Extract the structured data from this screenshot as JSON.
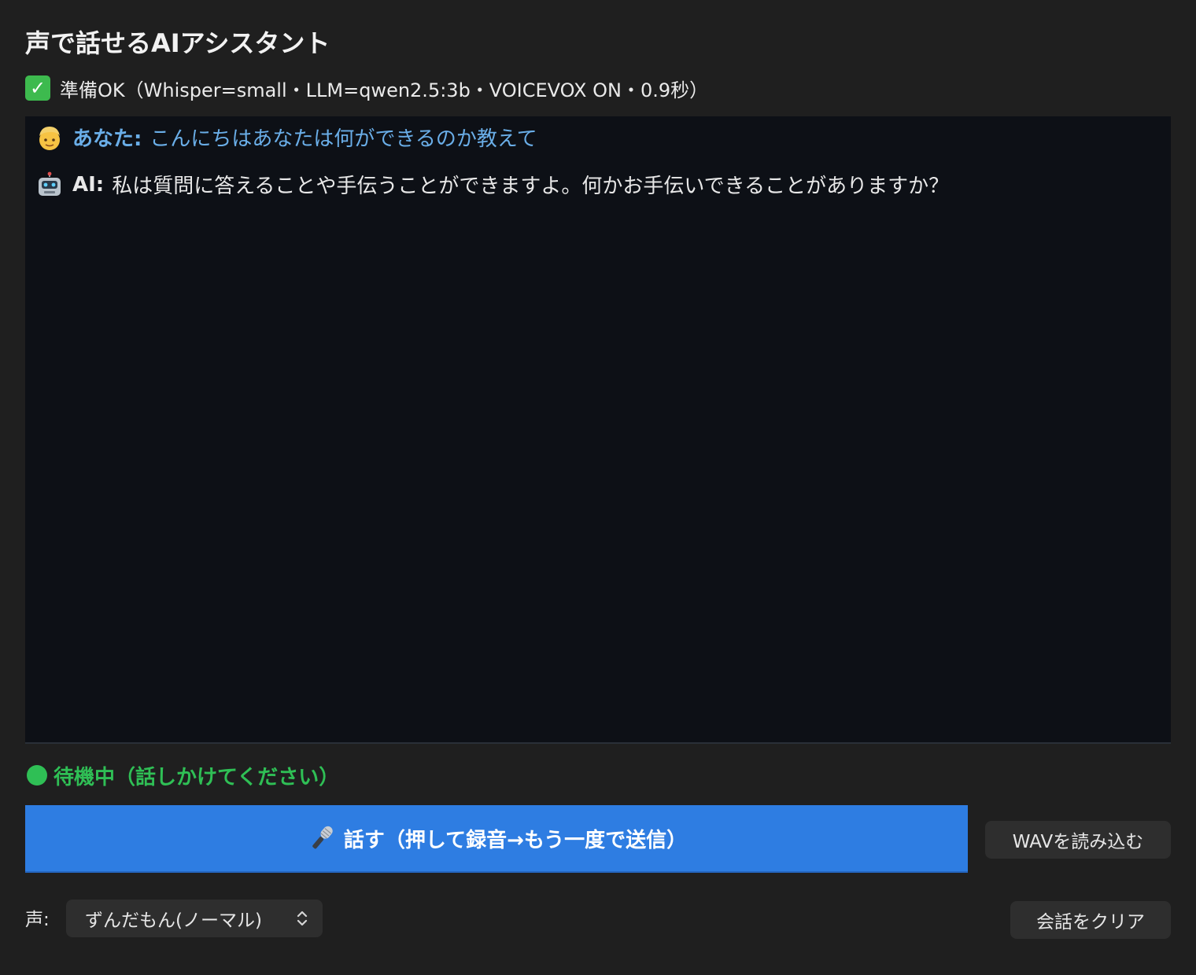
{
  "app": {
    "title": "声で話せるAIアシスタント"
  },
  "status": {
    "icon": "check-icon",
    "text": "準備OK（Whisper=small・LLM=qwen2.5:3b・VOICEVOX ON・0.9秒）"
  },
  "chat": {
    "messages": [
      {
        "avatar_icon": "person-icon",
        "speaker": "あなた:",
        "text": "こんにちはあなたは何ができるのか教えて",
        "color": "#6aaee8"
      },
      {
        "avatar_icon": "robot-icon",
        "speaker": "AI:",
        "text": "私は質問に答えることや手伝うことができますよ。何かお手伝いできることがありますか？",
        "color": "#e8e8e8"
      }
    ]
  },
  "listening": {
    "indicator_icon": "green-dot-icon",
    "text": "待機中（話しかけてください）",
    "color": "#2fbf55"
  },
  "controls": {
    "talk_button": {
      "icon": "microphone-icon",
      "label": "話す（押して録音→もう一度で送信）",
      "color": "#2e7de2"
    },
    "load_wav_label": "WAVを読み込む",
    "voice_label": "声:",
    "voice_selected": "ずんだもん(ノーマル)",
    "clear_label": "会話をクリア"
  }
}
